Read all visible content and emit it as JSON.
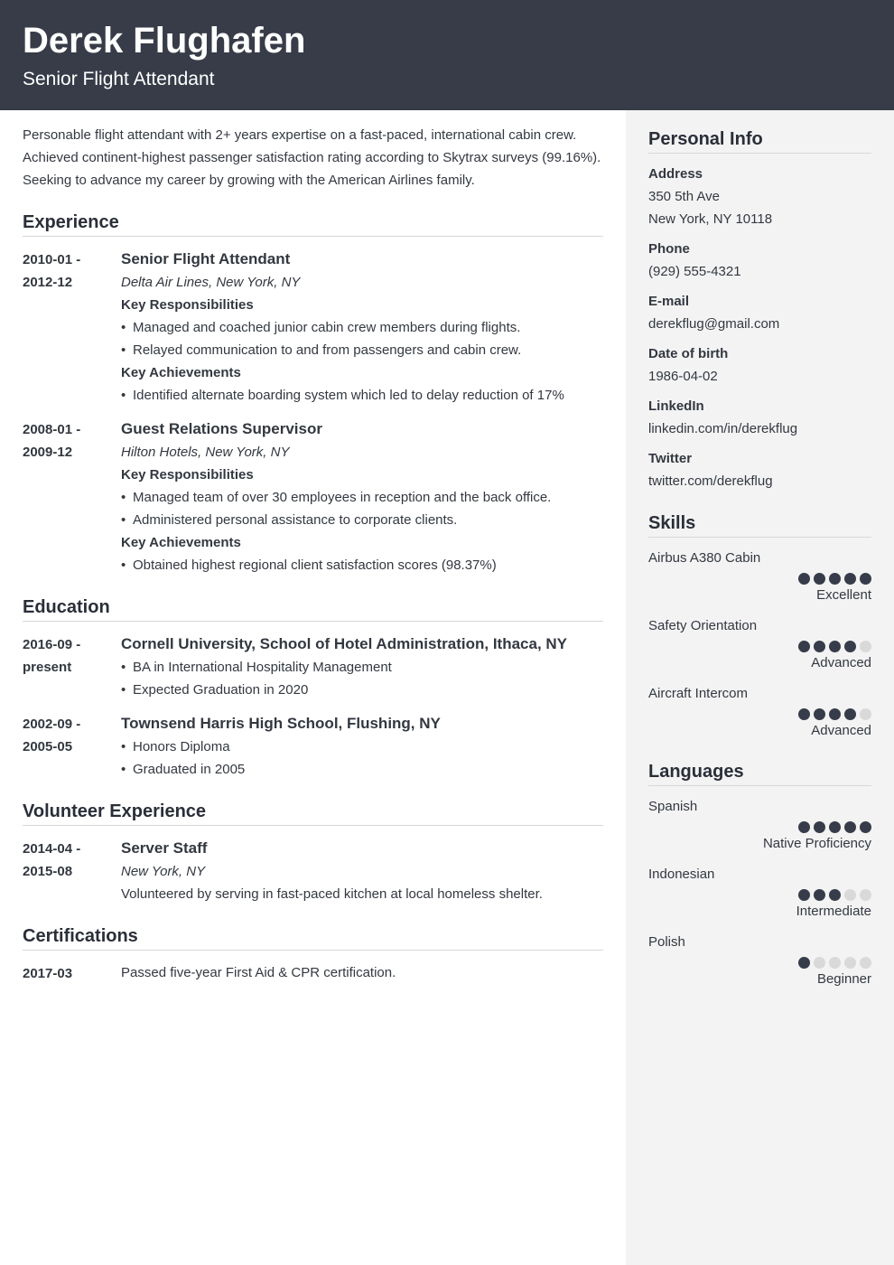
{
  "header": {
    "name": "Derek Flughafen",
    "title": "Senior Flight Attendant"
  },
  "colors": {
    "header_bg": "#373c48",
    "sidebar_bg": "#f3f3f3",
    "dot_filled": "#363c49",
    "dot_empty": "#d9d9d9"
  },
  "summary": "Personable flight attendant with 2+ years expertise on a fast-paced, international cabin crew. Achieved continent-highest passenger satisfaction rating according to Skytrax surveys (99.16%). Seeking to advance my career by growing with the American Airlines family.",
  "experience": {
    "title": "Experience",
    "entries": [
      {
        "date_start": "2010-01 -",
        "date_end": "2012-12",
        "role": "Senior Flight Attendant",
        "org": "Delta Air Lines, New York, NY",
        "resp_label": "Key Responsibilities",
        "responsibilities": [
          "Managed and coached junior cabin crew members during flights.",
          "Relayed communication to and from passengers and cabin crew."
        ],
        "ach_label": "Key Achievements",
        "achievements": [
          "Identified alternate boarding system which led to delay reduction of 17%"
        ]
      },
      {
        "date_start": "2008-01 -",
        "date_end": "2009-12",
        "role": "Guest Relations Supervisor",
        "org": "Hilton Hotels, New York, NY",
        "resp_label": "Key Responsibilities",
        "responsibilities": [
          "Managed team of over 30 employees in reception and the back office.",
          "Administered personal assistance to corporate clients."
        ],
        "ach_label": "Key Achievements",
        "achievements": [
          "Obtained highest regional client satisfaction scores (98.37%)"
        ]
      }
    ]
  },
  "education": {
    "title": "Education",
    "entries": [
      {
        "date_start": "2016-09 -",
        "date_end": "present",
        "school": "Cornell University, School of Hotel Administration, Ithaca, NY",
        "items": [
          "BA in International Hospitality Management",
          "Expected Graduation in 2020"
        ]
      },
      {
        "date_start": "2002-09 -",
        "date_end": "2005-05",
        "school": "Townsend Harris High School, Flushing, NY",
        "items": [
          "Honors Diploma",
          "Graduated in 2005"
        ]
      }
    ]
  },
  "volunteer": {
    "title": "Volunteer Experience",
    "entries": [
      {
        "date_start": "2014-04 -",
        "date_end": "2015-08",
        "role": "Server Staff",
        "org": "New York, NY",
        "description": "Volunteered by serving in fast-paced kitchen at local homeless shelter."
      }
    ]
  },
  "certifications": {
    "title": "Certifications",
    "entries": [
      {
        "date": "2017-03",
        "text": "Passed five-year First Aid & CPR certification."
      }
    ]
  },
  "personal_info": {
    "title": "Personal Info",
    "address_label": "Address",
    "address_line1": "350 5th Ave",
    "address_line2": "New York, NY 10118",
    "phone_label": "Phone",
    "phone": "(929) 555-4321",
    "email_label": "E-mail",
    "email": "derekflug@gmail.com",
    "dob_label": "Date of birth",
    "dob": "1986-04-02",
    "linkedin_label": "LinkedIn",
    "linkedin": "linkedin.com/in/derekflug",
    "twitter_label": "Twitter",
    "twitter": "twitter.com/derekflug"
  },
  "skills": {
    "title": "Skills",
    "items": [
      {
        "name": "Airbus A380 Cabin",
        "rating": 5,
        "max": 5,
        "level": "Excellent"
      },
      {
        "name": "Safety Orientation",
        "rating": 4,
        "max": 5,
        "level": "Advanced"
      },
      {
        "name": "Aircraft Intercom",
        "rating": 4,
        "max": 5,
        "level": "Advanced"
      }
    ]
  },
  "languages": {
    "title": "Languages",
    "items": [
      {
        "name": "Spanish",
        "rating": 5,
        "max": 5,
        "level": "Native Proficiency"
      },
      {
        "name": "Indonesian",
        "rating": 3,
        "max": 5,
        "level": "Intermediate"
      },
      {
        "name": "Polish",
        "rating": 1,
        "max": 5,
        "level": "Beginner"
      }
    ]
  }
}
